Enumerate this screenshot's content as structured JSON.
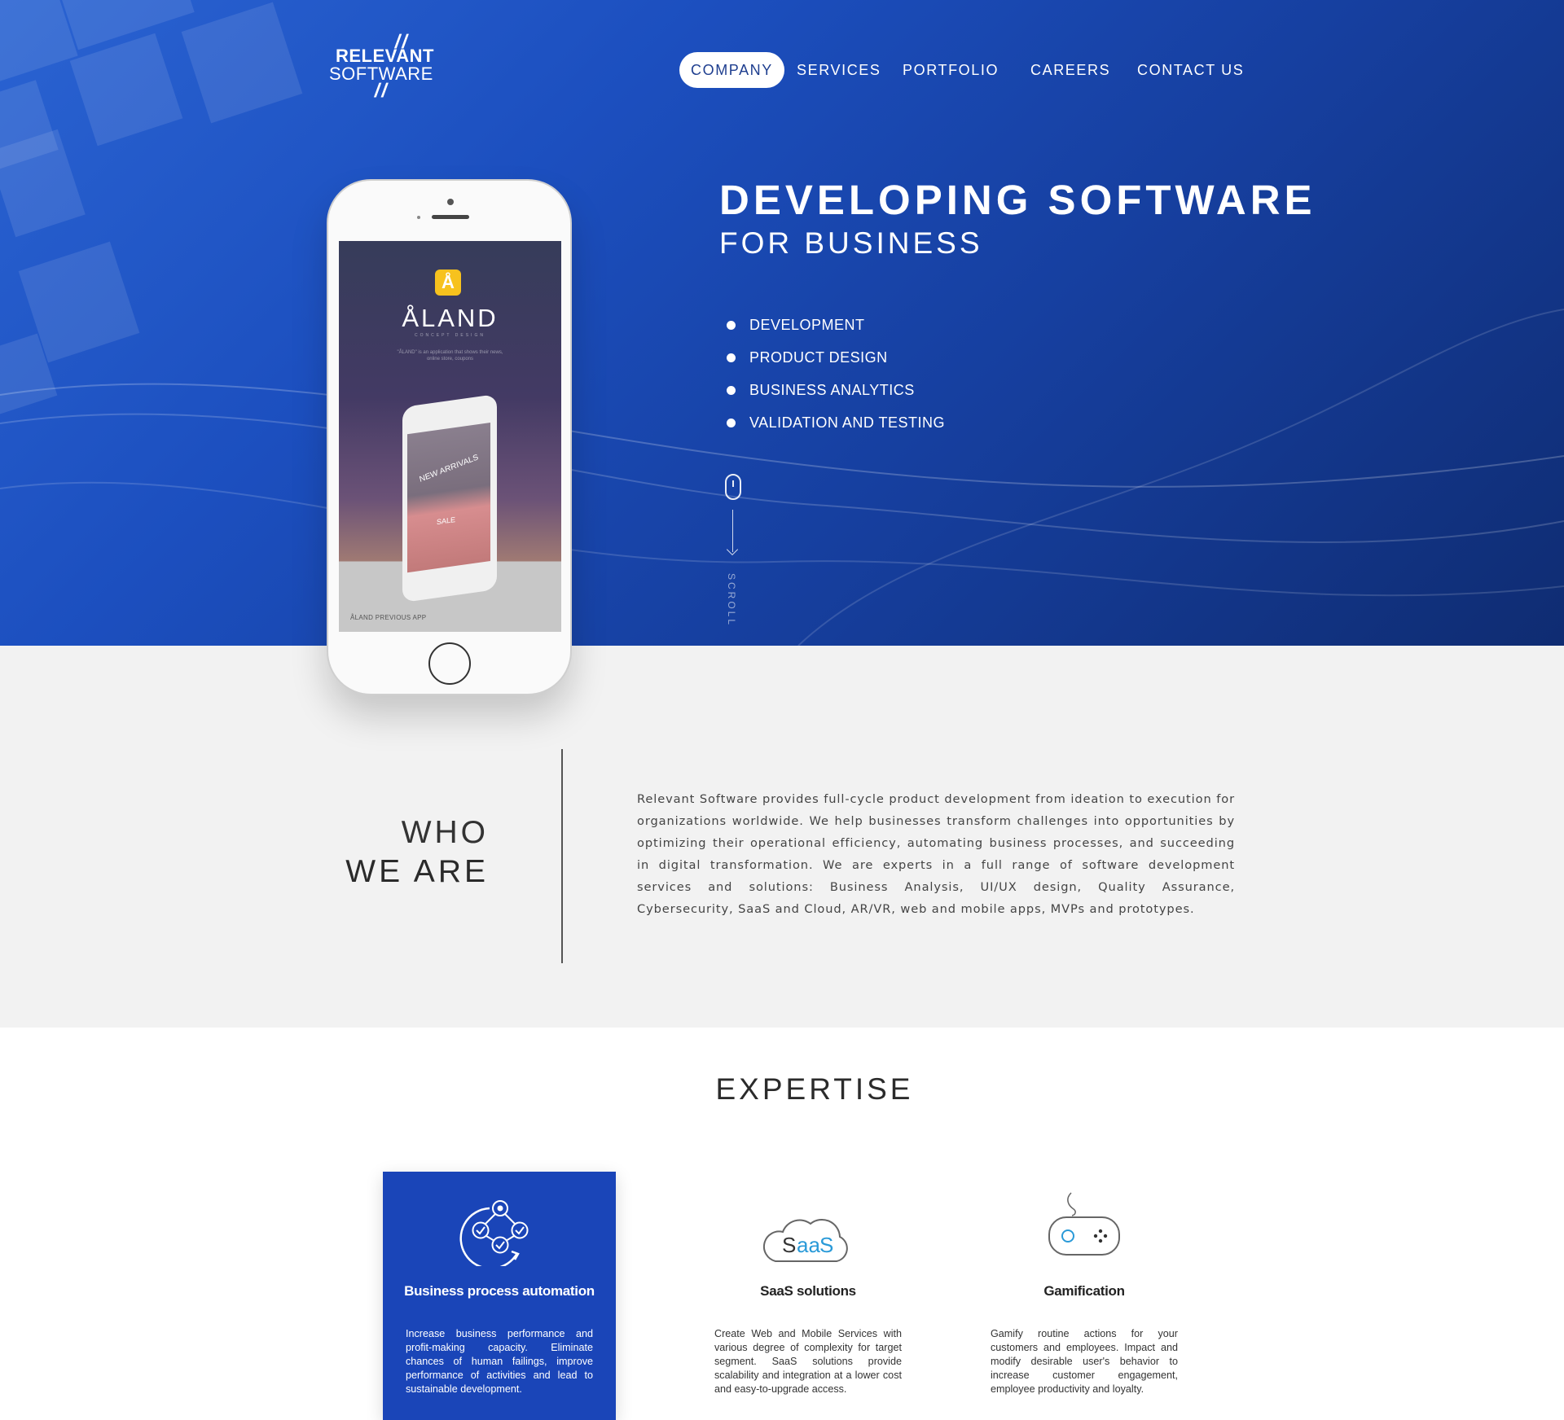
{
  "brand": {
    "logo_top": "RELEVANT",
    "logo_bottom": "SOFTWARE",
    "logo_mark": "//"
  },
  "nav": {
    "items": [
      {
        "label": "COMPANY",
        "active": true
      },
      {
        "label": "SERVICES",
        "active": false
      },
      {
        "label": "PORTFOLIO",
        "active": false
      },
      {
        "label": "CAREERS",
        "active": false
      },
      {
        "label": "CONTACT US",
        "active": false
      }
    ]
  },
  "hero": {
    "title": "DEVELOPING SOFTWARE",
    "subtitle": "FOR BUSINESS",
    "services": [
      "DEVELOPMENT",
      "PRODUCT DESIGN",
      "BUSINESS ANALYTICS",
      "VALIDATION AND TESTING"
    ],
    "scroll_label": "SCROLL"
  },
  "phone": {
    "app_icon": "Å",
    "app_title": "ÅLAND",
    "app_tagline": "CONCEPT DESIGN",
    "app_desc": "\"ÅLAND\" is an application that shows their news, online store, coupons",
    "inner_text_1": "NEW ARRIVALS",
    "inner_text_2": "SALE",
    "caption": "ÅLAND PREVIOUS APP"
  },
  "who": {
    "title_line1": "WHO",
    "title_line2": "WE ARE",
    "text": "Relevant Software provides full-cycle product development from ideation to execution for organizations worldwide. We help businesses transform challenges into opportunities by optimizing their operational efficiency, automating business processes, and succeeding in digital transformation. We are experts in a full range of software development services and solutions: Business Analysis, UI/UX design, Quality Assurance, Cybersecurity, SaaS and Cloud, AR/VR, web and mobile apps, MVPs and prototypes."
  },
  "expertise": {
    "title": "EXPERTISE",
    "cards": [
      {
        "icon": "process-automation-icon",
        "title": "Business process automation",
        "desc": "Increase business performance and profit-making capacity. Eliminate chances of human failings, improve performance of activities and lead to sustainable development.",
        "active": true
      },
      {
        "icon": "saas-cloud-icon",
        "icon_text": "SaaS",
        "title": "SaaS solutions",
        "desc": "Create Web and Mobile Services with various degree of complexity for target segment. SaaS solutions provide scalability and integration at a lower cost and easy-to-upgrade access.",
        "active": false
      },
      {
        "icon": "gamepad-icon",
        "title": "Gamification",
        "desc": "Gamify routine actions for your customers and employees. Impact and modify desirable user's behavior to increase customer engagement, employee productivity and loyalty.",
        "active": false
      }
    ]
  },
  "colors": {
    "hero_blue": "#1c4fbf",
    "card_blue": "#1a45b8",
    "section_grey": "#f2f2f2",
    "saas_accent": "#2a9ad8"
  }
}
